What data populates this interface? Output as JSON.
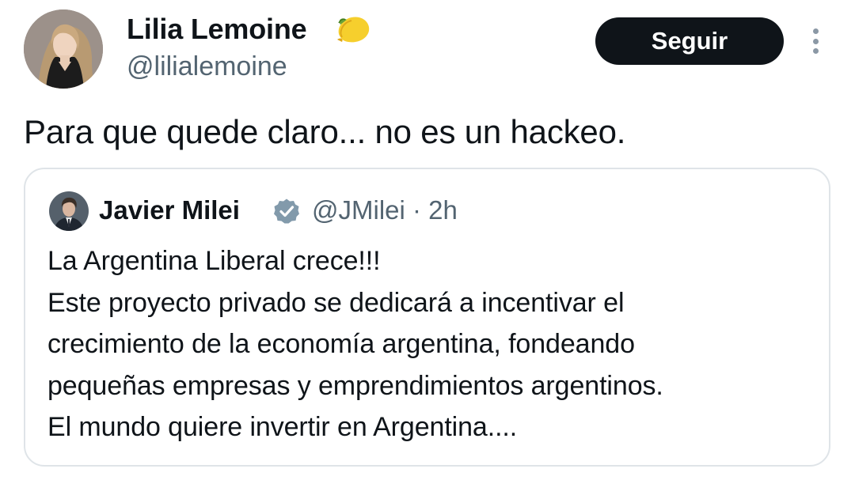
{
  "author": {
    "name": "Lilia Lemoine",
    "handle": "@lilialemoine",
    "badge_icon": "lemon-icon",
    "avatar_icon": "profile-photo"
  },
  "follow_button": {
    "label": "Seguir"
  },
  "more_button": {
    "icon": "more-vertical-icon"
  },
  "tweet": {
    "text": "Para que quede claro... no es un hackeo."
  },
  "quoted_tweet": {
    "author_name": "Javier Milei",
    "handle_time": "@JMilei · 2h",
    "verified_icon": "verified-badge-icon",
    "verified_color": "#829aab",
    "lines": [
      "La Argentina Liberal crece!!!",
      "Este proyecto privado se dedicará a incentivar el",
      "crecimiento de la economía argentina, fondeando",
      "pequeñas empresas y emprendimientos argentinos.",
      "El mundo quiere invertir en Argentina...."
    ]
  },
  "colors": {
    "text": "#0f1419",
    "secondary_text": "#536471",
    "button_bg": "#0f1419",
    "button_text": "#ffffff",
    "border": "#dfe4e8"
  }
}
